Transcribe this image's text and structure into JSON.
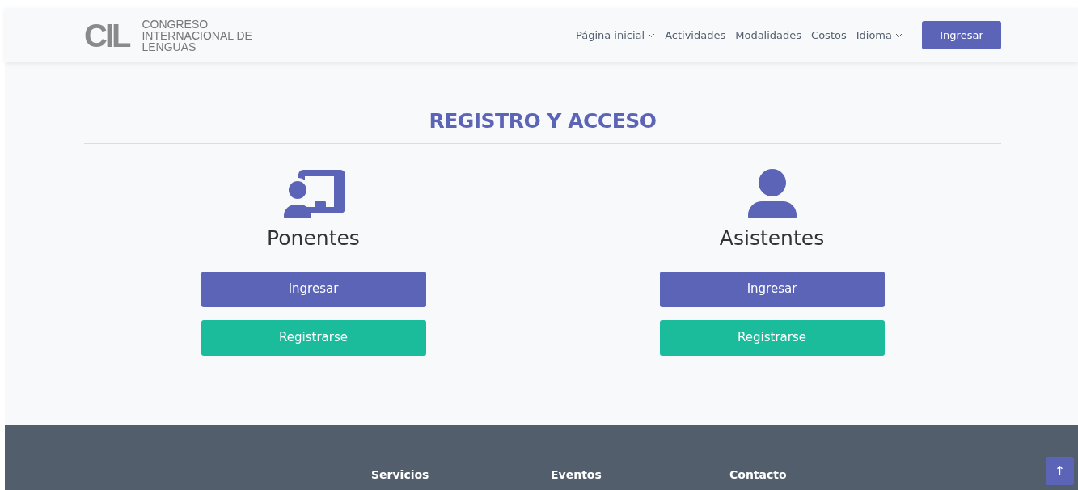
{
  "header": {
    "logo_text": "CIL",
    "brand_text": "CONGRESO INTERNACIONAL DE LENGUAS",
    "nav": [
      {
        "label": "Página inicial",
        "dropdown": true
      },
      {
        "label": "Actividades",
        "dropdown": false
      },
      {
        "label": "Modalidades",
        "dropdown": false
      },
      {
        "label": "Costos",
        "dropdown": false
      },
      {
        "label": "Idioma",
        "dropdown": true
      }
    ],
    "login_button": "Ingresar"
  },
  "title": "REGISTRO Y ACCESO",
  "groups": [
    {
      "kind": "presenter",
      "name": "Ponentes",
      "buttons": [
        "Ingresar",
        "Registrarse"
      ]
    },
    {
      "kind": "attendee",
      "name": "Asistentes",
      "buttons": [
        "Ingresar",
        "Registrarse"
      ]
    }
  ],
  "footer": {
    "headings": [
      "Servicios",
      "Eventos",
      "Contacto"
    ],
    "back_to_top": "↑"
  }
}
